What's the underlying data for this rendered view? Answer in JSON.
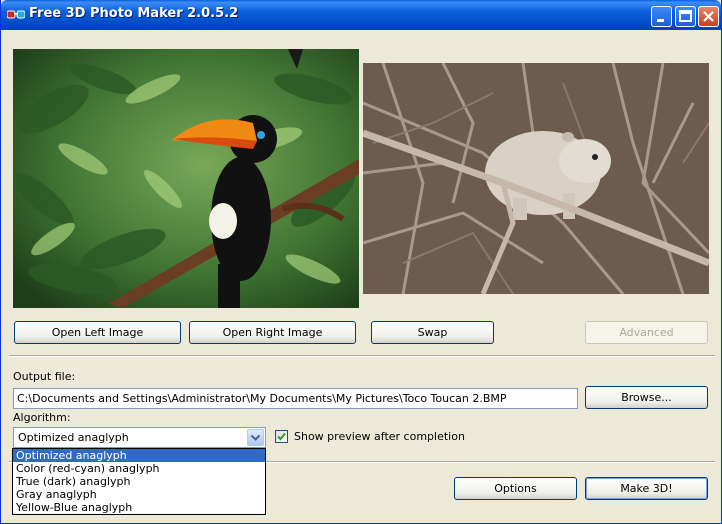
{
  "window": {
    "title": "Free 3D Photo Maker 2.0.5.2"
  },
  "toolbar": {
    "open_left": "Open Left Image",
    "open_right": "Open Right Image",
    "swap": "Swap",
    "advanced": "Advanced"
  },
  "output": {
    "label": "Output file:",
    "value": "C:\\Documents and Settings\\Administrator\\My Documents\\My Pictures\\Toco Toucan 2.BMP",
    "browse": "Browse..."
  },
  "algorithm": {
    "label": "Algorithm:",
    "selected": "Optimized anaglyph",
    "options": [
      "Optimized anaglyph",
      "Color (red-cyan) anaglyph",
      "True (dark) anaglyph",
      "Gray anaglyph",
      "Yellow-Blue anaglyph"
    ]
  },
  "preview": {
    "label": "Show preview after completion",
    "checked": true
  },
  "actions": {
    "options": "Options",
    "make3d": "Make 3D!"
  },
  "colors": {
    "titlebar": "#0a5fd8",
    "selection": "#316ac5",
    "face": "#ece9d8"
  }
}
